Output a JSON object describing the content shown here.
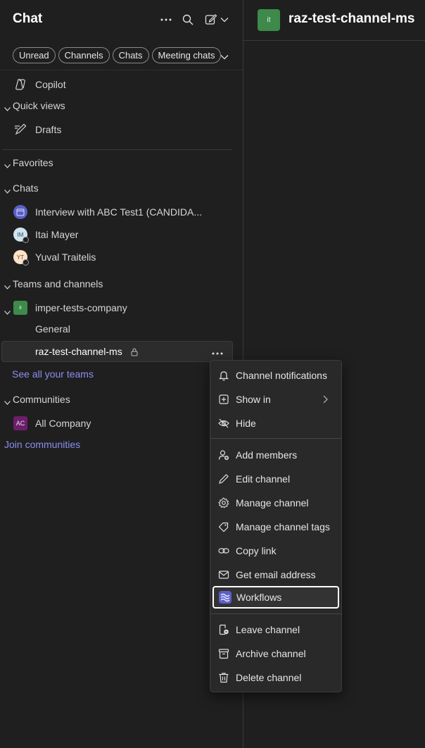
{
  "header": {
    "title": "Chat",
    "filters": [
      "Unread",
      "Channels",
      "Chats",
      "Meeting chats"
    ]
  },
  "sidebar": {
    "copilot": "Copilot",
    "quick_views": "Quick views",
    "drafts": "Drafts",
    "favorites": "Favorites",
    "chats_section": "Chats",
    "chats": [
      {
        "label": "Interview with ABC Test1 (CANDIDA...",
        "avatar": ""
      },
      {
        "label": "Itai Mayer",
        "avatar": "IM"
      },
      {
        "label": "Yuval Traitelis",
        "avatar": "YT"
      }
    ],
    "teams_section": "Teams and channels",
    "team": {
      "label": "imper-tests-company",
      "avatar": "it"
    },
    "channels": [
      "General",
      "raz-test-channel-ms"
    ],
    "see_all_teams": "See all your teams",
    "communities_section": "Communities",
    "community": {
      "label": "All Company",
      "avatar": "AC"
    },
    "join_communities": "Join communities"
  },
  "main": {
    "channel_avatar": "it",
    "channel_title": "raz-test-channel-ms"
  },
  "context_menu": {
    "group1": [
      {
        "label": "Channel notifications",
        "icon": "bell-icon"
      },
      {
        "label": "Show in",
        "icon": "plus-square-icon"
      },
      {
        "label": "Hide",
        "icon": "eye-off-icon"
      }
    ],
    "group2": [
      {
        "label": "Add members",
        "icon": "person-add-icon"
      },
      {
        "label": "Edit channel",
        "icon": "pencil-icon"
      },
      {
        "label": "Manage channel",
        "icon": "gear-icon"
      },
      {
        "label": "Manage channel tags",
        "icon": "tag-icon"
      },
      {
        "label": "Copy link",
        "icon": "link-icon"
      },
      {
        "label": "Get email address",
        "icon": "mail-icon"
      },
      {
        "label": "Workflows",
        "icon": "workflows-icon"
      }
    ],
    "group3": [
      {
        "label": "Leave channel",
        "icon": "leave-icon"
      },
      {
        "label": "Archive channel",
        "icon": "archive-icon"
      },
      {
        "label": "Delete channel",
        "icon": "trash-icon"
      }
    ]
  },
  "colors": {
    "accent_link": "#8b8ff0",
    "background": "#1f1f1f",
    "team_avatar": "#3d8a4a",
    "community_avatar": "#6b1f6b"
  }
}
